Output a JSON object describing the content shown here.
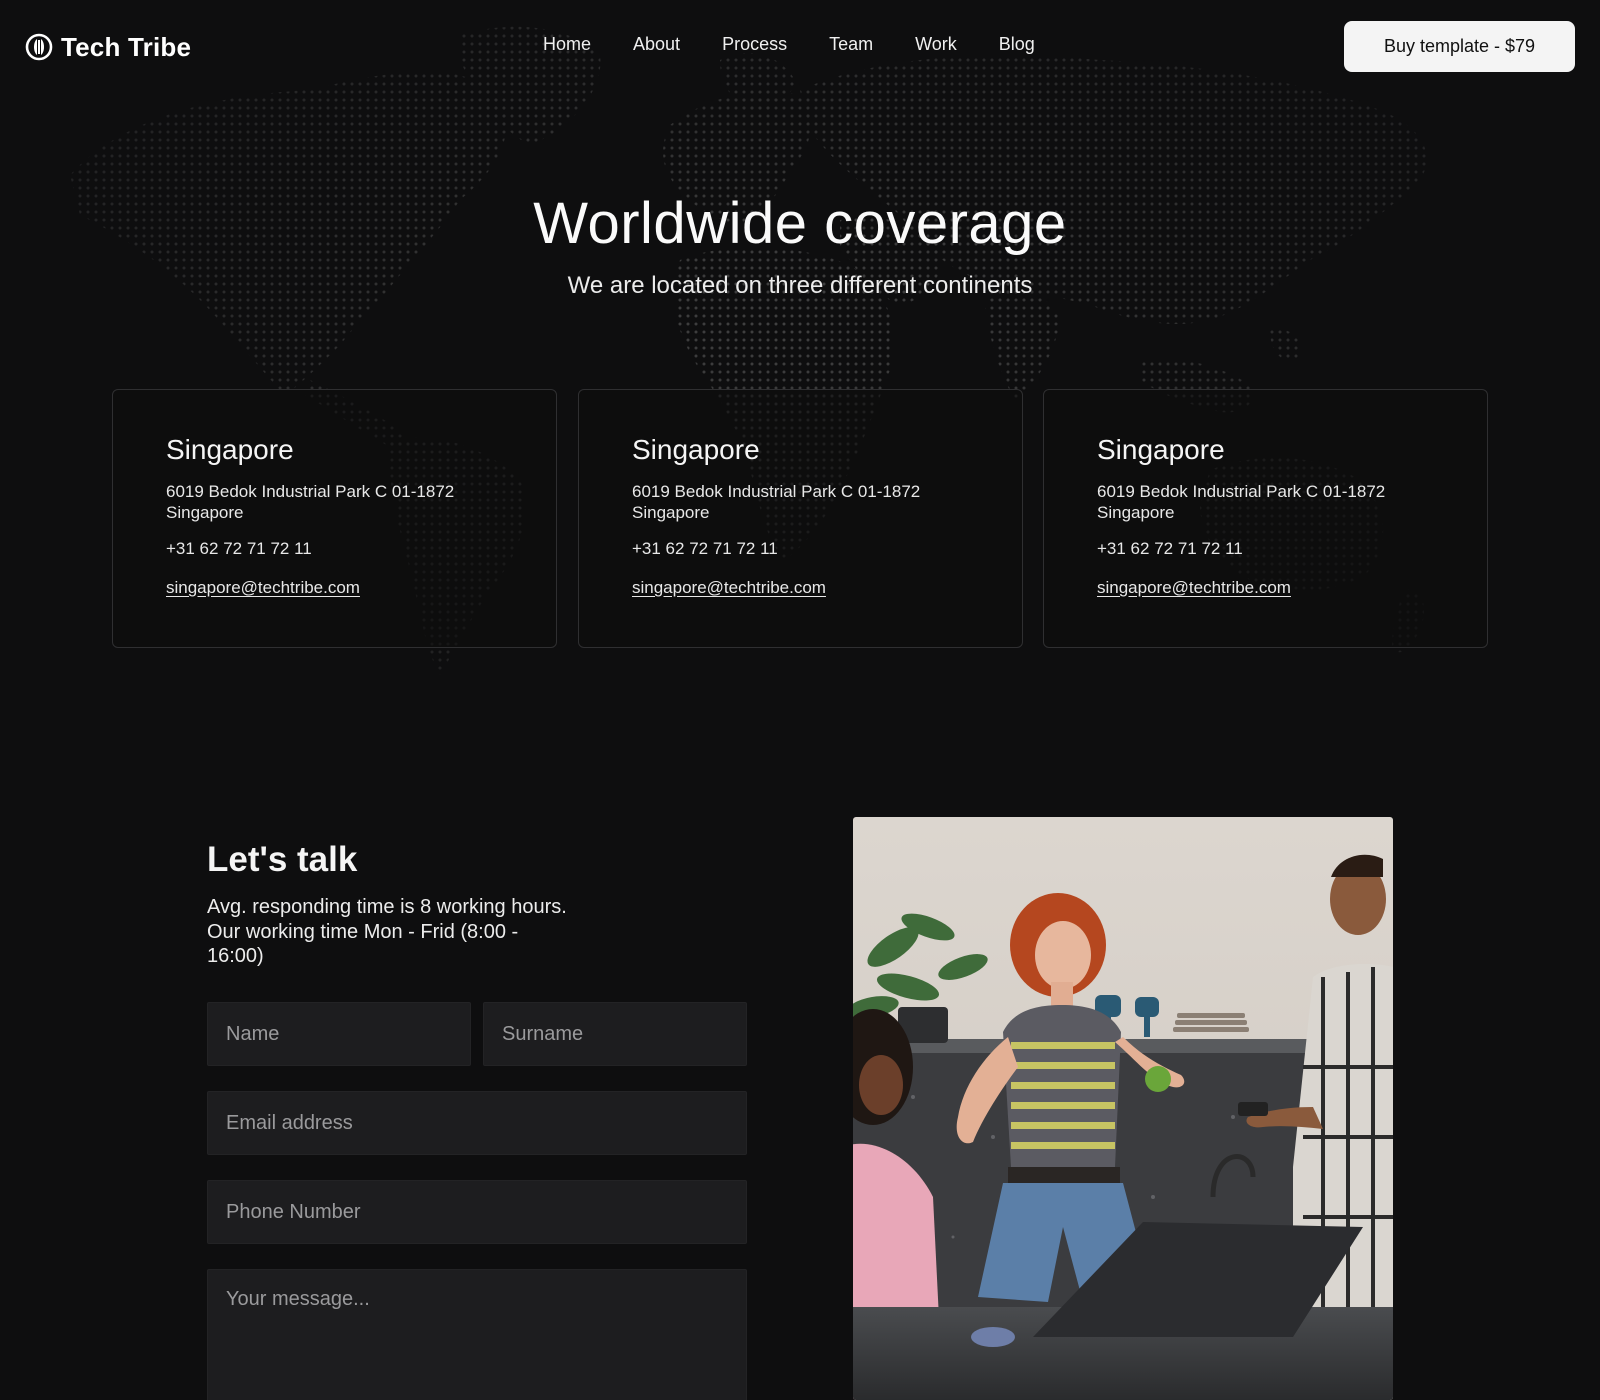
{
  "brand": {
    "name": "Tech Tribe"
  },
  "nav": {
    "links": [
      "Home",
      "About",
      "Process",
      "Team",
      "Work",
      "Blog"
    ],
    "cta_label": "Buy template - $79"
  },
  "hero": {
    "title": "Worldwide coverage",
    "subtitle": "We are located on three different continents"
  },
  "offices": [
    {
      "city": "Singapore",
      "address_line1": "6019 Bedok Industrial Park C 01-1872",
      "address_line2": "Singapore",
      "phone": "+31 62 72 71 72 11",
      "email": "singapore@techtribe.com"
    },
    {
      "city": "Singapore",
      "address_line1": "6019 Bedok Industrial Park C 01-1872",
      "address_line2": "Singapore",
      "phone": "+31 62 72 71 72 11",
      "email": "singapore@techtribe.com"
    },
    {
      "city": "Singapore",
      "address_line1": "6019 Bedok Industrial Park C 01-1872",
      "address_line2": "Singapore",
      "phone": "+31 62 72 71 72 11",
      "email": "singapore@techtribe.com"
    }
  ],
  "contact": {
    "title": "Let's talk",
    "description": "Avg. responding time is 8 working hours. Our working time Mon - Frid (8:00 - 16:00)",
    "form": {
      "name_placeholder": "Name",
      "surname_placeholder": "Surname",
      "email_placeholder": "Email address",
      "phone_placeholder": "Phone Number",
      "message_placeholder": "Your message..."
    }
  },
  "colors": {
    "background": "#0e0e0f",
    "card_border": "#2f2f31",
    "input_bg": "#1d1d1f",
    "button_bg": "#f4f4f4",
    "text": "#f2f2f2"
  }
}
